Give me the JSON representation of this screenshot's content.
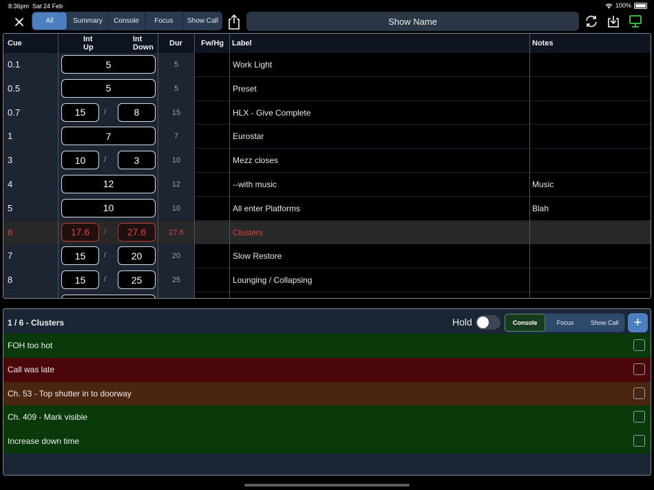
{
  "status": {
    "time": "8:36pm",
    "date": "Sat 24 Feb",
    "battery": "100%"
  },
  "toolbar": {
    "tabs": [
      {
        "label": "All",
        "active": true
      },
      {
        "label": "Summary",
        "active": false
      },
      {
        "label": "Console",
        "active": false
      },
      {
        "label": "Focus",
        "active": false
      },
      {
        "label": "Show Call",
        "active": false
      }
    ],
    "show_name": "Show Name",
    "icons": [
      "close-icon",
      "share-icon",
      "sync-icon",
      "download-icon",
      "display-icon"
    ]
  },
  "table": {
    "headers": {
      "cue": "Cue",
      "int_up_a": "Int",
      "int_up_b": "Up",
      "int_down_a": "Int",
      "int_down_b": "Down",
      "dur": "Dur",
      "fwhg": "Fw/Hg",
      "label": "Label",
      "notes": "Notes"
    },
    "rows": [
      {
        "cue": "0.1",
        "up": "5",
        "down": "",
        "dur": "5",
        "label": "Work Light",
        "notes": ""
      },
      {
        "cue": "0.5",
        "up": "5",
        "down": "",
        "dur": "5",
        "label": "Preset",
        "notes": ""
      },
      {
        "cue": "0.7",
        "up": "15",
        "down": "8",
        "dur": "15",
        "label": "HLX - Give Complete",
        "notes": ""
      },
      {
        "cue": "1",
        "up": "7",
        "down": "",
        "dur": "7",
        "label": "Eurostar",
        "notes": ""
      },
      {
        "cue": "3",
        "up": "10",
        "down": "3",
        "dur": "10",
        "label": "Mezz closes",
        "notes": ""
      },
      {
        "cue": "4",
        "up": "12",
        "down": "",
        "dur": "12",
        "label": "--with music",
        "notes": "Music"
      },
      {
        "cue": "5",
        "up": "10",
        "down": "",
        "dur": "10",
        "label": "All enter Platforms",
        "notes": "Blah"
      },
      {
        "cue": "6",
        "up": "17.6",
        "down": "27.6",
        "dur": "27.6",
        "label": "Clusters",
        "notes": "",
        "selected": true
      },
      {
        "cue": "7",
        "up": "15",
        "down": "20",
        "dur": "20",
        "label": "Slow Restore",
        "notes": ""
      },
      {
        "cue": "8",
        "up": "15",
        "down": "25",
        "dur": "25",
        "label": "Lounging / Collapsing",
        "notes": ""
      }
    ],
    "separator": "/"
  },
  "notes_panel": {
    "title": "1 / 6 - Clusters",
    "hold_label": "Hold",
    "hold_on": false,
    "tabs": [
      {
        "label": "Console",
        "active": true
      },
      {
        "label": "Focus",
        "active": false
      },
      {
        "label": "Show Call",
        "active": false
      }
    ],
    "add_label": "+",
    "items": [
      {
        "text": "FOH too hot",
        "color": "green"
      },
      {
        "text": "Call was late",
        "color": "red"
      },
      {
        "text": "Ch. 53 - Top shutter in to doorway",
        "color": "orange"
      },
      {
        "text": "Ch. 409 - Mark visible",
        "color": "green"
      },
      {
        "text": "Increase down time",
        "color": "green"
      }
    ]
  },
  "colors": {
    "accent": "#4c7fbf",
    "selected_cue": "#e0433e",
    "note_green": "#0a3a0a",
    "note_red": "#4a0608",
    "note_orange": "#4a2610"
  }
}
